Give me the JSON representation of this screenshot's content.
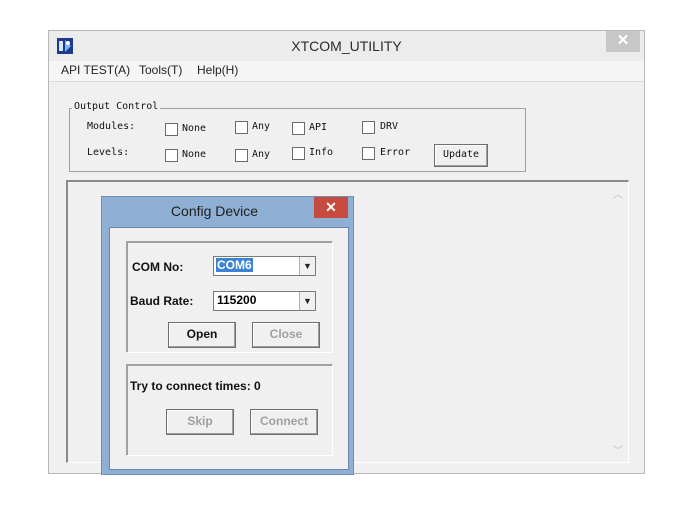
{
  "window": {
    "title": "XTCOM_UTILITY",
    "close_glyph": "✕"
  },
  "menu": [
    "API TEST(A)",
    "Tools(T)",
    "Help(H)"
  ],
  "output_control": {
    "label": "Output Control",
    "modules_label": "Modules:",
    "levels_label": "Levels:",
    "modules": [
      "None",
      "Any",
      "API",
      "DRV"
    ],
    "levels": [
      "None",
      "Any",
      "Info",
      "Error"
    ],
    "update_button": "Update"
  },
  "dialog": {
    "title": "Config Device",
    "close_glyph": "✕",
    "com_label": "COM No:",
    "com_value": "COM6",
    "baud_label": "Baud Rate:",
    "baud_value": "115200",
    "open_button": "Open",
    "close_button": "Close",
    "status_text": "Try to connect times: 0",
    "skip_button": "Skip",
    "connect_button": "Connect"
  },
  "colors": {
    "dialog_frame": "#8fb0d4",
    "dialog_close": "#c74a3f",
    "selection": "#3b83d6"
  }
}
